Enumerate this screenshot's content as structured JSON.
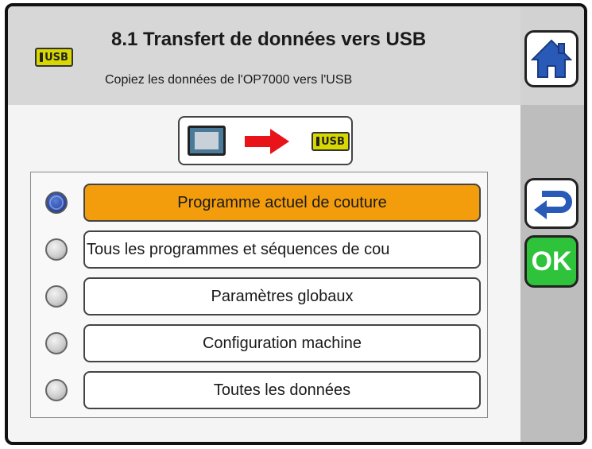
{
  "header": {
    "usb_badge": "USB",
    "title": "8.1 Transfert de données vers USB",
    "subtitle": "Copiez les données de l'OP7000 vers l'USB"
  },
  "nav": {
    "home_icon": "home-icon",
    "back_icon": "back-arrow-icon",
    "ok_label": "OK"
  },
  "transfer": {
    "source_icon": "machine-screen-icon",
    "arrow_icon": "red-arrow-right-icon",
    "target_badge": "USB"
  },
  "options": [
    {
      "label": "Programme actuel de couture",
      "selected": true
    },
    {
      "label": "Tous les programmes et séquences de cou",
      "selected": false
    },
    {
      "label": "Paramètres globaux",
      "selected": false
    },
    {
      "label": "Configuration machine",
      "selected": false
    },
    {
      "label": "Toutes les données",
      "selected": false
    }
  ],
  "colors": {
    "selected_option": "#f39c0c",
    "ok_button": "#2fc23b",
    "home_icon": "#2a5ab8",
    "usb_badge": "#d8d800",
    "arrow": "#e8141a"
  }
}
